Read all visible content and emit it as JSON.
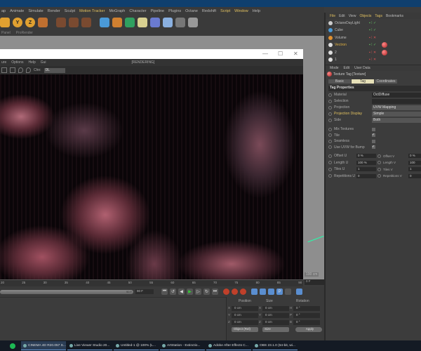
{
  "menubar": [
    "ap",
    "Animate",
    "Simulate",
    "Render",
    "Sculpt",
    "Motion Tracker",
    "MoGraph",
    "Character",
    "Pipeline",
    "Plugins",
    "Octane",
    "Redshift",
    "Script",
    "Window",
    "Help"
  ],
  "toolbar": {
    "axis_y": "Y",
    "axis_z": "Z"
  },
  "viewport": {
    "labels": [
      "Panel",
      "ProRender"
    ],
    "scale": "100 cm"
  },
  "live_viewer": {
    "menu": [
      "ure",
      "Options",
      "Help",
      "Gui"
    ],
    "status": "[RENDERING]",
    "chn_label": "Chn:",
    "chn_value": "DL",
    "min": "—",
    "max": "☐",
    "close": "✕"
  },
  "timeline": {
    "ticks": [
      "20",
      "25",
      "30",
      "35",
      "40",
      "45",
      "50",
      "55",
      "60",
      "65",
      "70",
      "75",
      "80",
      "85",
      "90"
    ],
    "current_frame": "0 F",
    "end_frame": "90 F",
    "slider_end": "90 F"
  },
  "coordinates": {
    "headers": [
      "Position",
      "Size",
      "Rotation"
    ],
    "axes_pos": [
      "X",
      "Y",
      "Z"
    ],
    "axes_size": [
      "X",
      "Y",
      "Z"
    ],
    "axes_rot": [
      "H",
      "P",
      "B"
    ],
    "position": [
      "0 cm",
      "0 cm",
      "0 cm"
    ],
    "size": [
      "0 cm",
      "0 cm",
      "0 cm"
    ],
    "rotation": [
      "0 °",
      "0 °",
      "0 °"
    ],
    "mode": "Object (Rel)",
    "size_mode": "Size",
    "apply": "Apply"
  },
  "object_manager": {
    "menu": [
      "File",
      "Edit",
      "View",
      "Objects",
      "Tags",
      "Bookmarks"
    ],
    "objects": [
      "OctaneDayLight",
      "Cube",
      "Volume",
      "Vectron",
      "2",
      "1"
    ]
  },
  "attributes": {
    "menu": [
      "Mode",
      "Edit",
      "User Data"
    ],
    "title": "Texture Tag [Texture]",
    "tabs": [
      "Basic",
      "Tag",
      "Coordinates"
    ],
    "section": "Tag Properties",
    "props": [
      {
        "label": "Material",
        "value": "OctDiffuse"
      },
      {
        "label": "Selection",
        "value": ""
      },
      {
        "label": "Projection",
        "value": "UVW Mapping"
      },
      {
        "label": "Projection Display",
        "value": "Simple"
      },
      {
        "label": "Side",
        "value": "Both"
      }
    ],
    "checks": [
      {
        "label": "Mix Textures",
        "checked": false
      },
      {
        "label": "Tile",
        "checked": true
      },
      {
        "label": "Seamless",
        "checked": false
      },
      {
        "label": "Use UVW for Bump",
        "checked": true
      }
    ],
    "numeric": [
      {
        "l1": "Offset U",
        "v1": "0 %",
        "l2": "Offset V",
        "v2": "0 %"
      },
      {
        "l1": "Length U",
        "v1": "100 %",
        "l2": "Length V",
        "v2": "100"
      },
      {
        "l1": "Tiles U",
        "v1": "1",
        "l2": "Tiles V",
        "v2": "1"
      },
      {
        "l1": "Repetitions U",
        "v1": "0",
        "l2": "Repetitions V",
        "v2": "0"
      }
    ]
  },
  "taskbar": [
    "CINEMA 4D R20.057 S...",
    "Live Viewer Studio 20...",
    "Untitled-1 @ 100% (L...",
    "ArtStation - Extinctio...",
    "Adobe After Effects C...",
    "OBS 23.1.0 (64-bit, wi..."
  ]
}
